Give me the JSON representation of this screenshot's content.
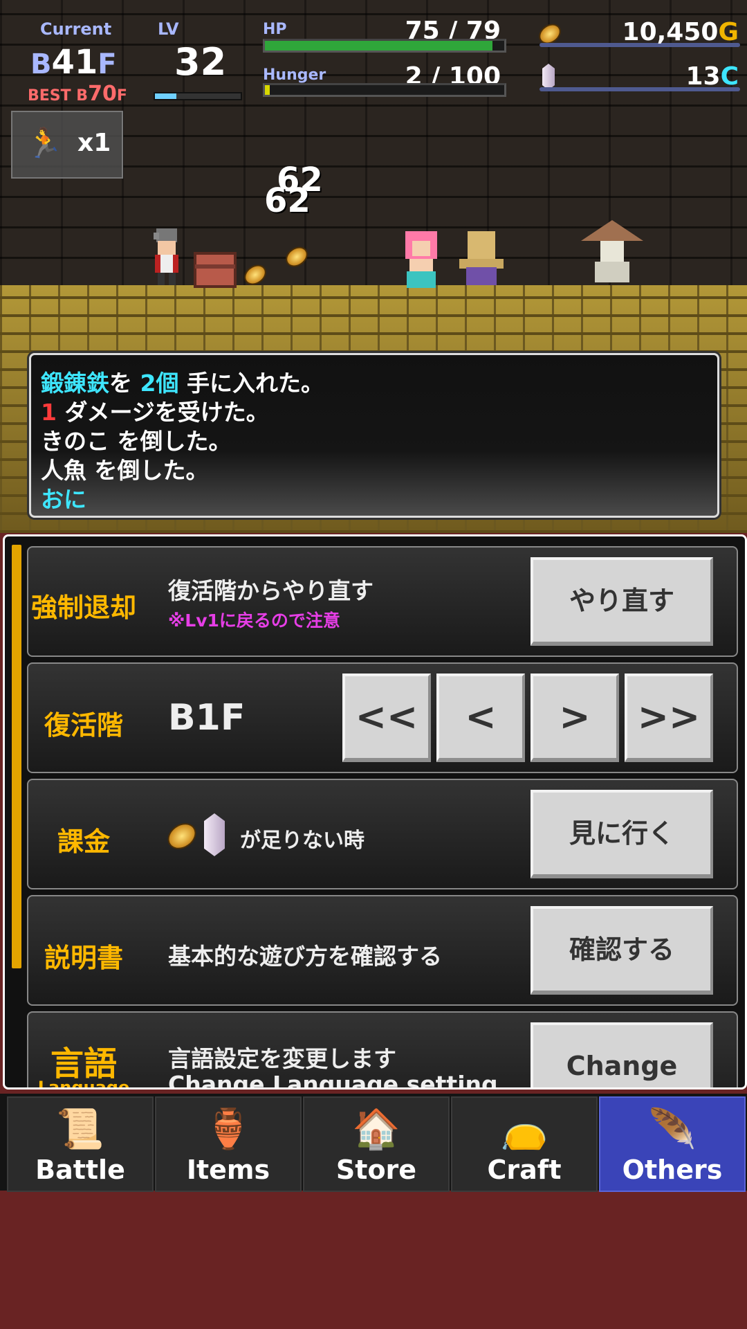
{
  "hud": {
    "current_label": "Current",
    "floor_prefix": "B",
    "floor_number": "41",
    "floor_suffix": "F",
    "best_label": "BEST B",
    "best_number": "70",
    "best_suffix": "F",
    "lv_label": "LV",
    "lv_value": "32",
    "lv_progress": 0.25,
    "hp_label": "HP",
    "hp_value": "75 / 79",
    "hp_fraction": 0.95,
    "hunger_label": "Hunger",
    "hunger_value": "2 / 100",
    "hunger_fraction": 0.02,
    "gold_value": "10,450",
    "gold_unit": "G",
    "crystal_value": "13",
    "crystal_unit": "C",
    "speed_label": "x1",
    "colors": {
      "hp": "#2fa63a",
      "hunger": "#d8d800",
      "gold_unit": "#f0b400",
      "crystal_unit": "#3ee6ff"
    }
  },
  "battle": {
    "damage_numbers": [
      "62",
      "62"
    ]
  },
  "log": {
    "l1_item": "鍛錬鉄",
    "l1_mid": "を ",
    "l1_count": "2個",
    "l1_end": " 手に入れた。",
    "l2_num": "1",
    "l2_text": " ダメージを受けた。",
    "l3": "きのこ を倒した。",
    "l4": "人魚 を倒した。",
    "l5": "おに"
  },
  "menu": {
    "retreat": {
      "label": "強制退却",
      "desc": "復活階からやり直す",
      "warning": "※Lv1に戻るので注意",
      "button": "やり直す"
    },
    "respawn": {
      "label": "復活階",
      "value": "B1F",
      "buttons": [
        "<<",
        "<",
        ">",
        ">>"
      ]
    },
    "billing": {
      "label": "課金",
      "desc": "が足りない時",
      "button": "見に行く"
    },
    "manual": {
      "label": "説明書",
      "desc": "基本的な遊び方を確認する",
      "button": "確認する"
    },
    "language": {
      "label": "言語",
      "sublabel": "Language",
      "desc": "言語設定を変更します",
      "desc2": "Change Language setting",
      "button": "Change"
    }
  },
  "nav": {
    "tabs": [
      {
        "label": "Battle",
        "icon": "book-icon"
      },
      {
        "label": "Items",
        "icon": "pot-icon"
      },
      {
        "label": "Store",
        "icon": "house-icon"
      },
      {
        "label": "Craft",
        "icon": "bag-icon"
      },
      {
        "label": "Others",
        "icon": "quill-icon"
      }
    ],
    "active": 4
  }
}
